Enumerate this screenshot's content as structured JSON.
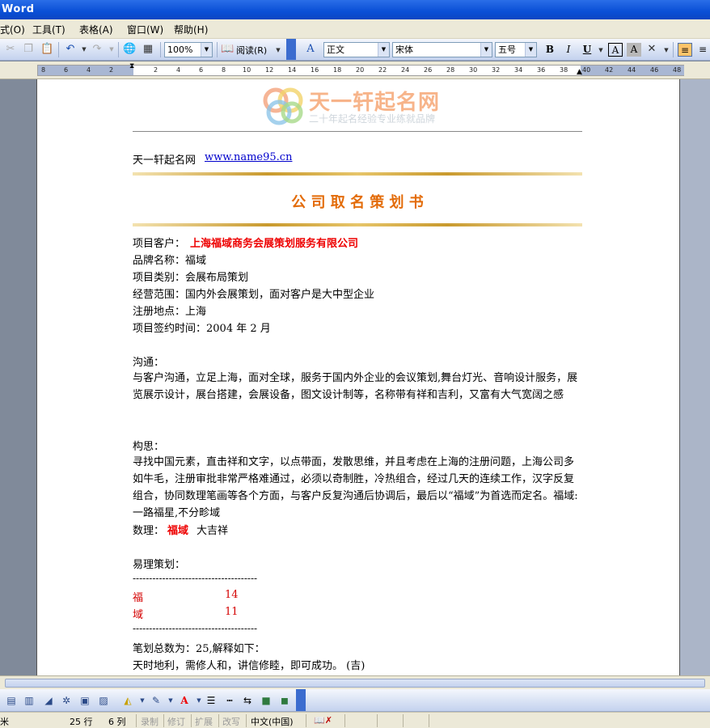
{
  "window": {
    "title": "Word"
  },
  "menu": [
    "式(O)",
    "工具(T)",
    "表格(A)",
    "窗口(W)",
    "帮助(H)"
  ],
  "toolbar": {
    "zoom": "100%",
    "read_label": "阅读(R)",
    "style": "正文",
    "font": "宋体",
    "size": "五号",
    "bold": "B",
    "italic": "I",
    "underline": "U",
    "char_border": "A",
    "char_shade": "A"
  },
  "ruler": [
    "8",
    "6",
    "4",
    "2",
    "2",
    "4",
    "6",
    "8",
    "10",
    "12",
    "14",
    "16",
    "18",
    "20",
    "22",
    "24",
    "26",
    "28",
    "30",
    "32",
    "34",
    "36",
    "38",
    "40",
    "42",
    "44",
    "46",
    "48"
  ],
  "logo": {
    "title": "天一轩起名网",
    "subtitle": "二十年起名经验专业练就品牌"
  },
  "doc": {
    "site_name": "天一轩起名网",
    "site_url": "www.name95.cn",
    "heading": "公 司 取 名 策 划 书",
    "client_label": "项目客户：",
    "client": "上海福域商务会展策划服务有限公司",
    "brand": "品牌名称：福域",
    "category": "项目类别：会展布局策划",
    "scope": "经营范围：国内外会展策划，面对客户是大中型企业",
    "location": "注册地点：上海",
    "signed": "项目签约时间：2004 年 2 月",
    "comm_title": "沟通：",
    "comm_body": "与客户沟通，立足上海，面对全球，服务于国内外企业的会议策划,舞台灯光、音响设计服务，展览展示设计，展台搭建，会展设备，图文设计制等，名称带有祥和吉利，又富有大气宽阔之感",
    "idea_title": "构思：",
    "idea_body": "寻找中国元素，直击祥和文字，以点带面，发散思维，并且考虑在上海的注册问题，上海公司多如牛毛，注册审批非常严格难通过，必须以奇制胜，冷热组合，经过几天的连续工作，汉字反复组合，协同数理笔画等各个方面，与客户反复沟通后协调后，最后以“福域”为首选而定名。福域:一路福星,不分畛域",
    "numerology_label": "数理：",
    "numerology_name": "福域",
    "numerology_result": "大吉祥",
    "yili_title": "易理策划：",
    "dash": "--------------------------------------",
    "chars": [
      {
        "char": "福",
        "strokes": "14"
      },
      {
        "char": "域",
        "strokes": "11"
      }
    ],
    "total": "笔划总数为：25,解释如下：",
    "explain": "天时地利，需修人和，讲信修睦，即可成功。 (吉)"
  },
  "status": {
    "unit": "米",
    "line": "25 行",
    "col": "6 列",
    "rec": "录制",
    "trk": "修订",
    "ext": "扩展",
    "ovr": "改写",
    "lang": "中文(中国)"
  }
}
